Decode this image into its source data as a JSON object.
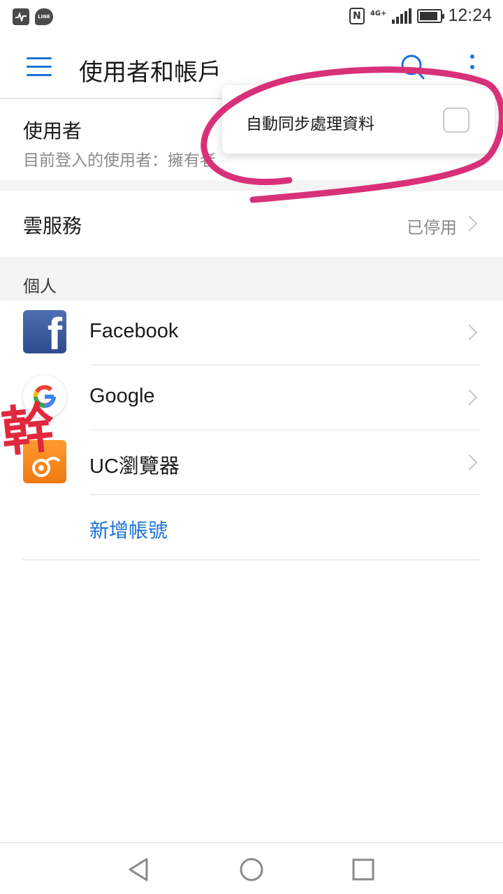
{
  "status_bar": {
    "notification_icons": [
      "activity-icon",
      "line-app-icon"
    ],
    "line_label": "LINE",
    "nfc_label": "N",
    "network_label": "4G+",
    "time": "12:24"
  },
  "app_bar": {
    "title": "使用者和帳戶",
    "icons": [
      "menu-icon",
      "search-icon",
      "more-vert-icon"
    ]
  },
  "user_section": {
    "title": "使用者",
    "subtitle": "目前登入的使用者：擁有者"
  },
  "cloud": {
    "label": "雲服務",
    "status": "已停用"
  },
  "personal": {
    "header": "個人",
    "accounts": [
      {
        "label": "Facebook",
        "icon": "facebook-icon"
      },
      {
        "label": "Google",
        "icon": "google-icon"
      },
      {
        "label": "UC瀏覽器",
        "icon": "uc-browser-icon"
      }
    ],
    "add_account": "新增帳號"
  },
  "popup_menu": {
    "item_label": "自動同步處理資料",
    "checked": false
  },
  "overlay": {
    "stamp_text": "幹",
    "scribble_color": "#d9307a",
    "stamp_color": "#e0283c"
  },
  "nav_bar": {
    "buttons": [
      "back-icon",
      "home-icon",
      "recents-icon"
    ]
  },
  "colors": {
    "accent": "#1a73d9",
    "secondary_text": "#8a8a8a",
    "divider": "#dedede"
  }
}
